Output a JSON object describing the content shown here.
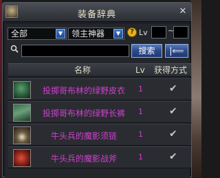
{
  "window": {
    "title": "装备辞典"
  },
  "filters": {
    "category": "全部",
    "subcategory": "领主神器",
    "lv_label": "Lv",
    "lv_separator": "~"
  },
  "search": {
    "value": "",
    "search_button": "搜索",
    "back_button": "|⟸"
  },
  "table": {
    "headers": {
      "name": "名称",
      "lv": "Lv",
      "source": "获得方式"
    },
    "rows": [
      {
        "name": "投掷哥布林的绿野皮衣",
        "lv": "1",
        "source": "✔",
        "icon": "green-armor-icon"
      },
      {
        "name": "投掷哥布林的绿野长裤",
        "lv": "1",
        "source": "✔",
        "icon": "green-pants-icon"
      },
      {
        "name": "牛头兵的魔影须链",
        "lv": "1",
        "source": "✔",
        "icon": "fang-necklace-icon"
      },
      {
        "name": "牛头兵的魔影战斧",
        "lv": "1",
        "source": "✔",
        "icon": "red-axe-icon"
      }
    ]
  }
}
